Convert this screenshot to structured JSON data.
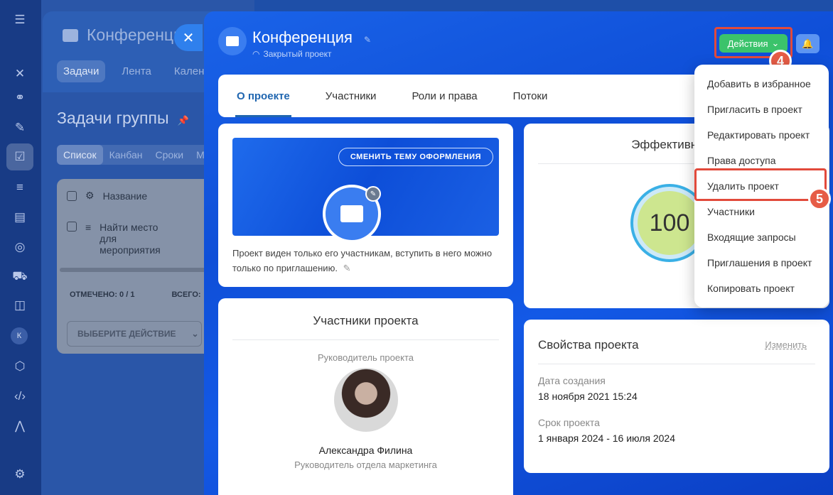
{
  "rail": {
    "avatar_letter": "К"
  },
  "background": {
    "title": "Конференция",
    "tabs": [
      "Задачи",
      "Лента",
      "Календ"
    ],
    "heading": "Задачи группы",
    "views": [
      "Список",
      "Канбан",
      "Сроки",
      "М"
    ],
    "table_header": "Название",
    "task_title": "Найти место для мероприятия",
    "checked_count": "ОТМЕЧЕНО: 0 / 1",
    "total_label": "ВСЕГО:",
    "action_placeholder": "ВЫБЕРИТЕ ДЕЙСТВИЕ"
  },
  "project": {
    "title": "Конференция",
    "subtitle": "Закрытый проект",
    "actions_label": "Действия"
  },
  "tabs": [
    "О проекте",
    "Участники",
    "Роли и права",
    "Потоки"
  ],
  "cover": {
    "theme_button": "СМЕНИТЬ ТЕМУ ОФОРМЛЕНИЯ",
    "note": "Проект виден только его участникам, вступить в него можно только по приглашению."
  },
  "members": {
    "title": "Участники проекта",
    "lead_label": "Руководитель проекта",
    "lead_name": "Александра Филина",
    "lead_role": "Руководитель отдела маркетинга"
  },
  "efficiency": {
    "title": "Эффективность",
    "value": "100"
  },
  "properties": {
    "title": "Свойства проекта",
    "edit_link": "Изменить",
    "created_label": "Дата создания",
    "created_value": "18 ноября 2021 15:24",
    "term_label": "Срок проекта",
    "term_value": "1 января 2024 - 16 июля 2024"
  },
  "menu": {
    "items": [
      "Добавить в избранное",
      "Пригласить в проект",
      "Редактировать проект",
      "Права доступа",
      "Удалить проект",
      "Участники",
      "Входящие запросы",
      "Приглашения в проект",
      "Копировать проект"
    ]
  },
  "steps": {
    "actions_step": "4",
    "delete_step": "5"
  },
  "colors": {
    "accent_green": "#3bc36b",
    "highlight_red": "#e24a3b",
    "panel_blue": "#0f4fd8"
  }
}
